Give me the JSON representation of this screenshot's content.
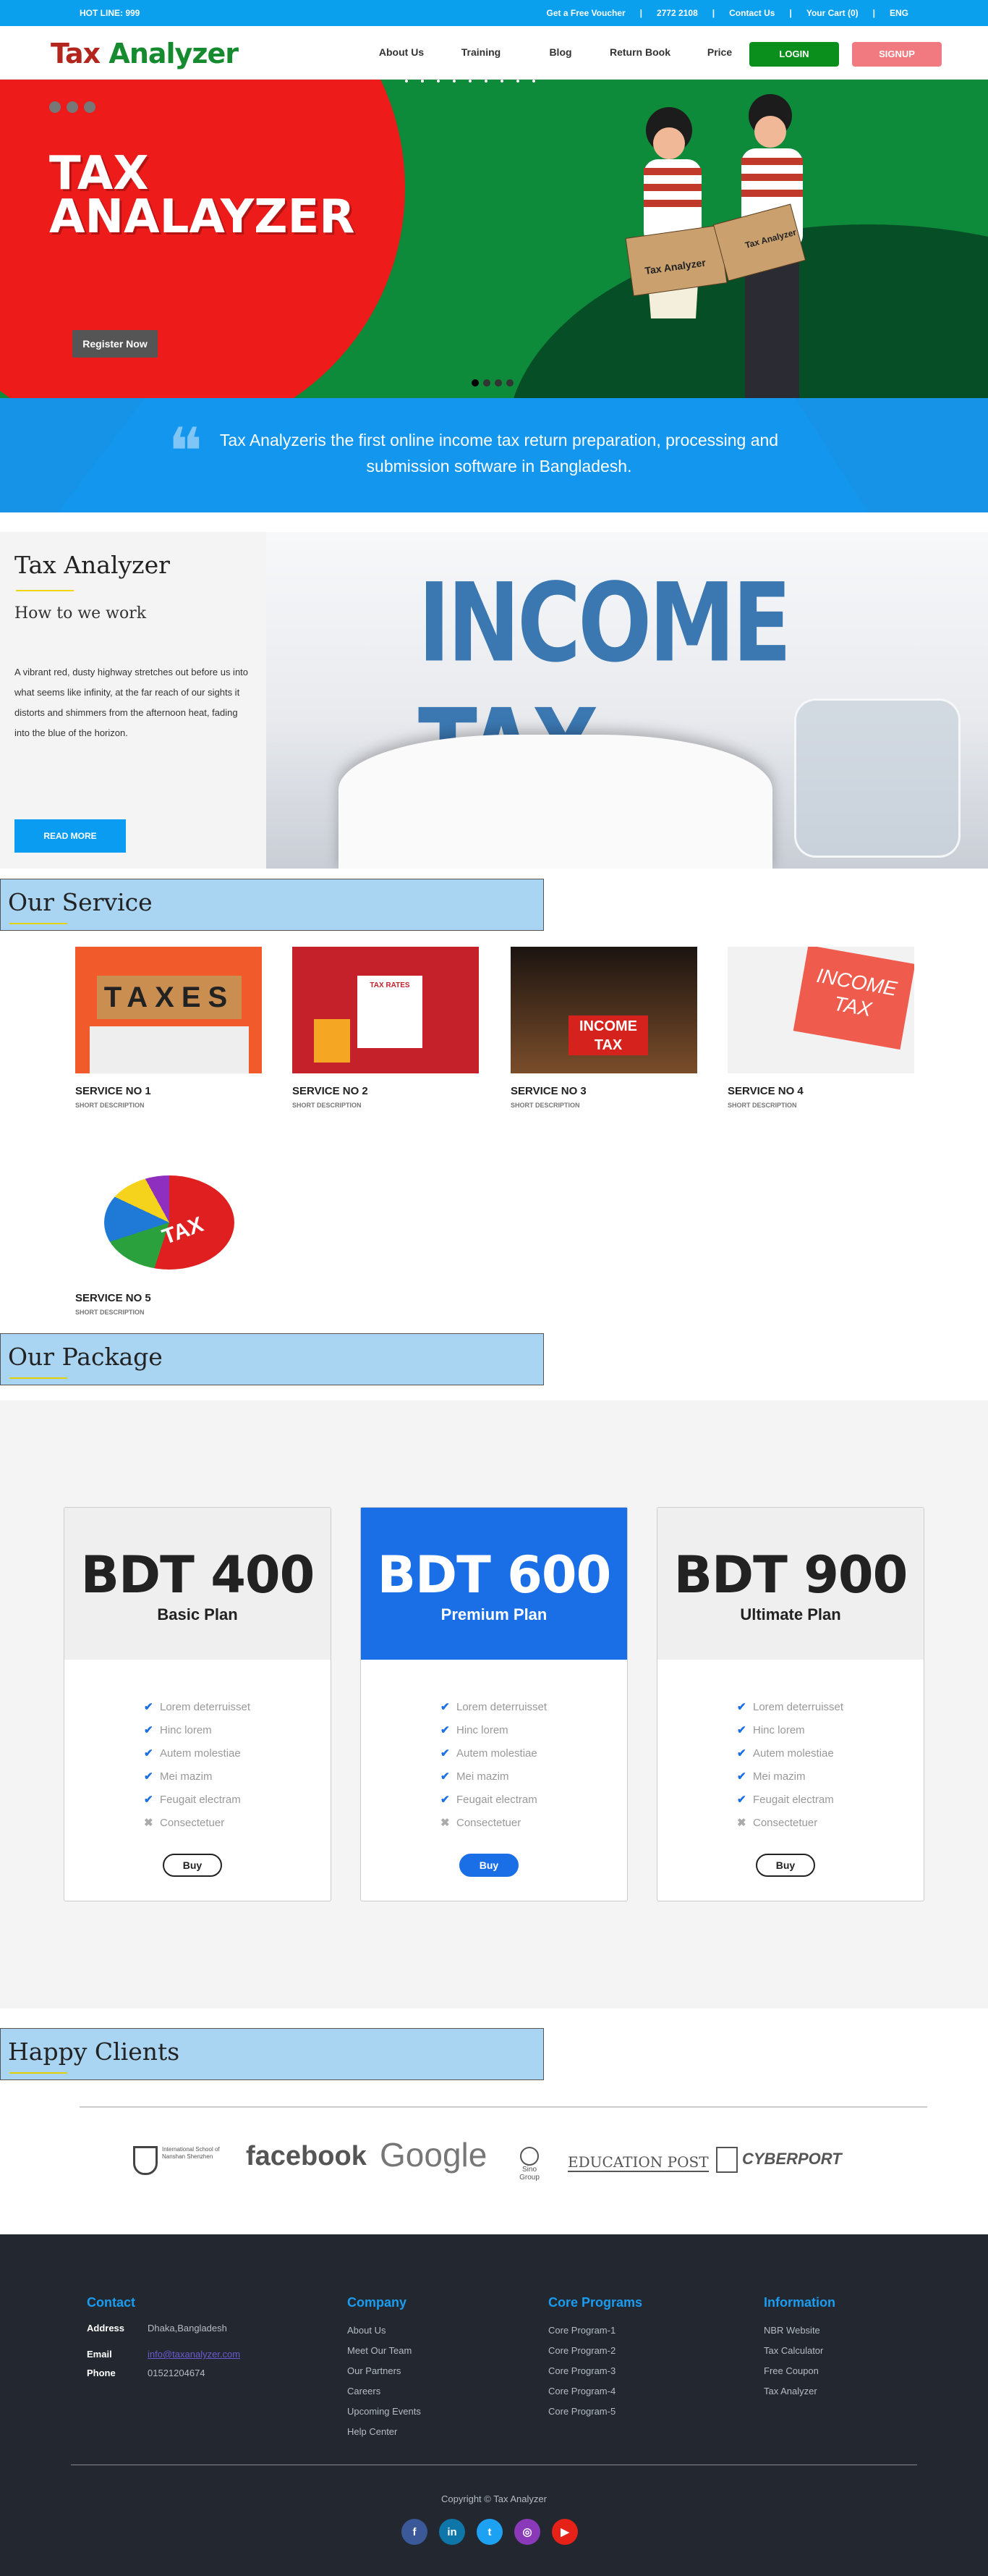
{
  "topbar": {
    "hotline": "HOT LINE: 999",
    "links": [
      "Get a Free Voucher",
      "|",
      "2772 2108",
      "|",
      "Contact Us",
      "|",
      "Your Cart (0)",
      "|",
      "ENG"
    ]
  },
  "nav": {
    "logo_a": "Tax",
    "logo_b": "Analyzer",
    "menu": [
      "About Us",
      "Training",
      "Blog",
      "Return Book",
      "Price"
    ],
    "login": "LOGIN",
    "signup": "SIGNUP"
  },
  "hero": {
    "title_line1": "TAX",
    "title_line2": "ANALAYZER",
    "register": "Register Now",
    "box_label": "Tax Analyzer",
    "box_label2": "Tax Analyzer"
  },
  "quote": {
    "text": "Tax Analyzeris the first online income tax return preparation, processing and submission software in Bangladesh."
  },
  "about": {
    "title": "Tax Analyzer",
    "subtitle": "How to we work",
    "body": "A vibrant red, dusty highway stretches out before us into what seems like infinity, at the far reach of our sights it distorts and shimmers from the afternoon heat, fading into the blue of the horizon.",
    "read_more": "READ MORE",
    "image_text": "INCOME TAX"
  },
  "services": {
    "heading": "Our Service",
    "items": [
      {
        "title": "SERVICE NO 1",
        "desc": "SHORT DESCRIPTION",
        "img_text": "TAXES"
      },
      {
        "title": "SERVICE NO 2",
        "desc": "SHORT DESCRIPTION",
        "img_text": "TAX RATES"
      },
      {
        "title": "SERVICE NO 3",
        "desc": "SHORT DESCRIPTION",
        "img_text": "INCOME TAX"
      },
      {
        "title": "SERVICE NO 4",
        "desc": "SHORT DESCRIPTION",
        "img_text": "INCOME TAX"
      },
      {
        "title": "SERVICE NO 5",
        "desc": "SHORT DESCRIPTION",
        "img_text": "TAX"
      }
    ]
  },
  "package": {
    "heading": "Our Package",
    "plans": [
      {
        "price": "BDT 400",
        "name": "Basic Plan",
        "buy": "Buy"
      },
      {
        "price": "BDT 600",
        "name": "Premium Plan",
        "buy": "Buy"
      },
      {
        "price": "BDT 900",
        "name": "Ultimate Plan",
        "buy": "Buy"
      }
    ],
    "features": [
      "Lorem deterruisset",
      "Hinc lorem",
      "Autem molestiae",
      "Mei mazim",
      "Feugait electram",
      "Consectetuer"
    ]
  },
  "clients": {
    "heading": "Happy Clients",
    "logos": [
      "International School of Nanshan Shenzhen",
      "facebook",
      "Google",
      "Sino Group",
      "EDUCATION POST",
      "CYBERPORT"
    ]
  },
  "footer": {
    "contact_title": "Contact",
    "address_label": "Address",
    "address": "Dhaka,Bangladesh",
    "email_label": "Email",
    "email": "info@taxanalyzer.com",
    "phone_label": "Phone",
    "phone": "01521204674",
    "company_title": "Company",
    "company": [
      "About Us",
      "Meet Our Team",
      "Our Partners",
      "Careers",
      "Upcoming Events",
      "Help Center"
    ],
    "programs_title": "Core Programs",
    "programs": [
      "Core Program-1",
      "Core Program-2",
      "Core Program-3",
      "Core Program-4",
      "Core Program-5"
    ],
    "info_title": "Information",
    "info": [
      "NBR Website",
      "Tax Calculator",
      "Free Coupon",
      "Tax Analyzer"
    ],
    "copyright": "Copyright © Tax Analyzer",
    "social": [
      {
        "name": "facebook",
        "glyph": "f",
        "color": "#3b5998"
      },
      {
        "name": "linkedin",
        "glyph": "in",
        "color": "#0e76a8"
      },
      {
        "name": "twitter",
        "glyph": "t",
        "color": "#1da1f2"
      },
      {
        "name": "instagram",
        "glyph": "◎",
        "color": "#8a3ab9"
      },
      {
        "name": "youtube",
        "glyph": "▶",
        "color": "#e62117"
      }
    ]
  }
}
